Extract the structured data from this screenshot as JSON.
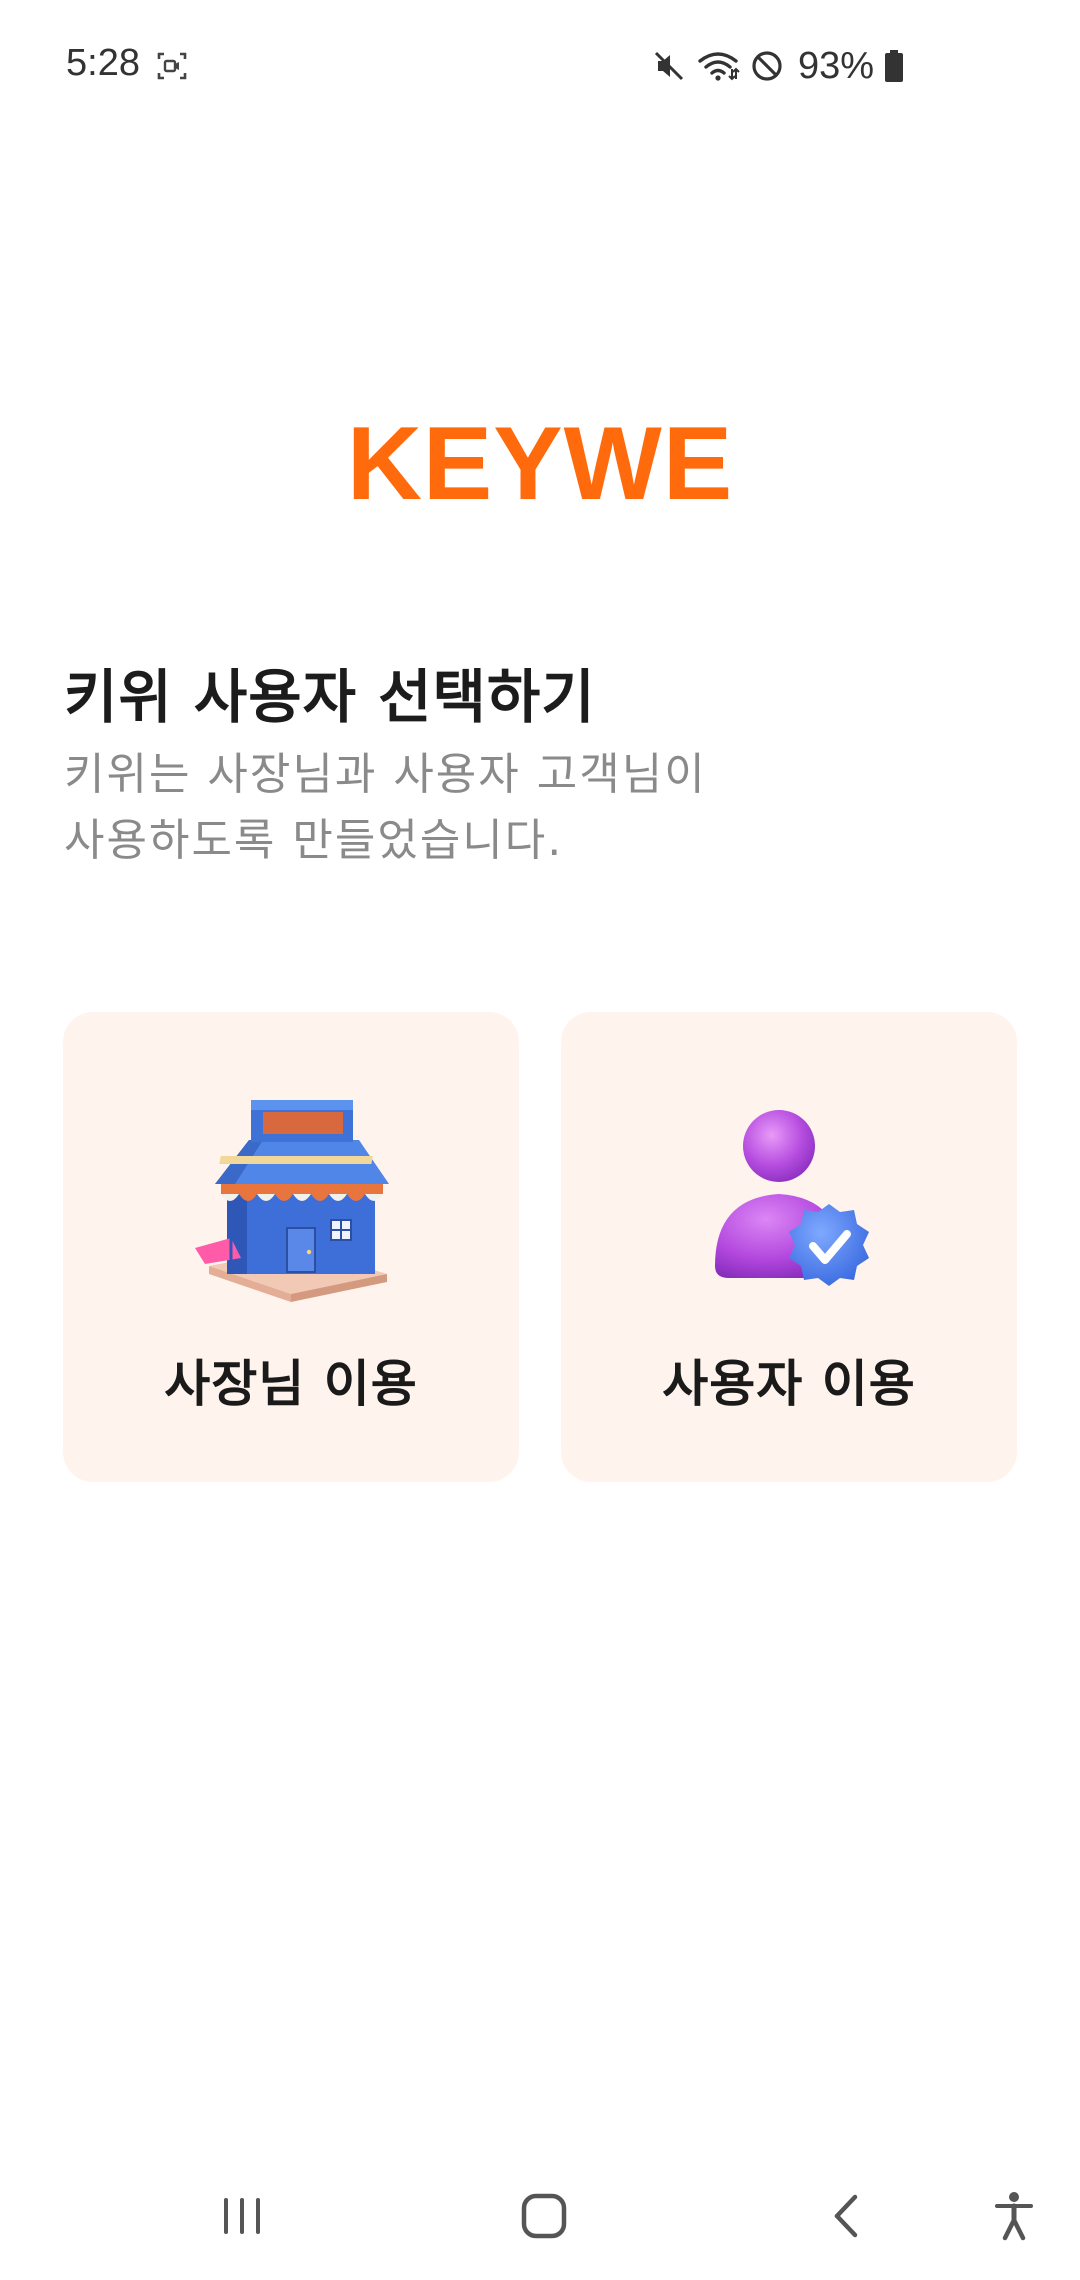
{
  "status_bar": {
    "time": "5:28",
    "battery": "93%",
    "icons": [
      "screen-record-icon",
      "mute-icon",
      "wifi-icon",
      "do-not-disturb-icon",
      "battery-icon"
    ]
  },
  "logo": {
    "text": "KEYWE",
    "color": "#ff6a0c"
  },
  "header": {
    "title": "키위 사용자 선택하기",
    "subtitle_line1": "키위는 사장님과 사용자 고객님이",
    "subtitle_line2": "사용하도록 만들었습니다."
  },
  "cards": {
    "owner": {
      "label": "사장님 이용",
      "icon": "store-icon"
    },
    "user": {
      "label": "사용자 이용",
      "icon": "verified-user-icon"
    },
    "background": "#fff3ee"
  },
  "nav_bar": {
    "icons": [
      "recents-icon",
      "home-icon",
      "back-icon",
      "accessibility-icon"
    ]
  }
}
